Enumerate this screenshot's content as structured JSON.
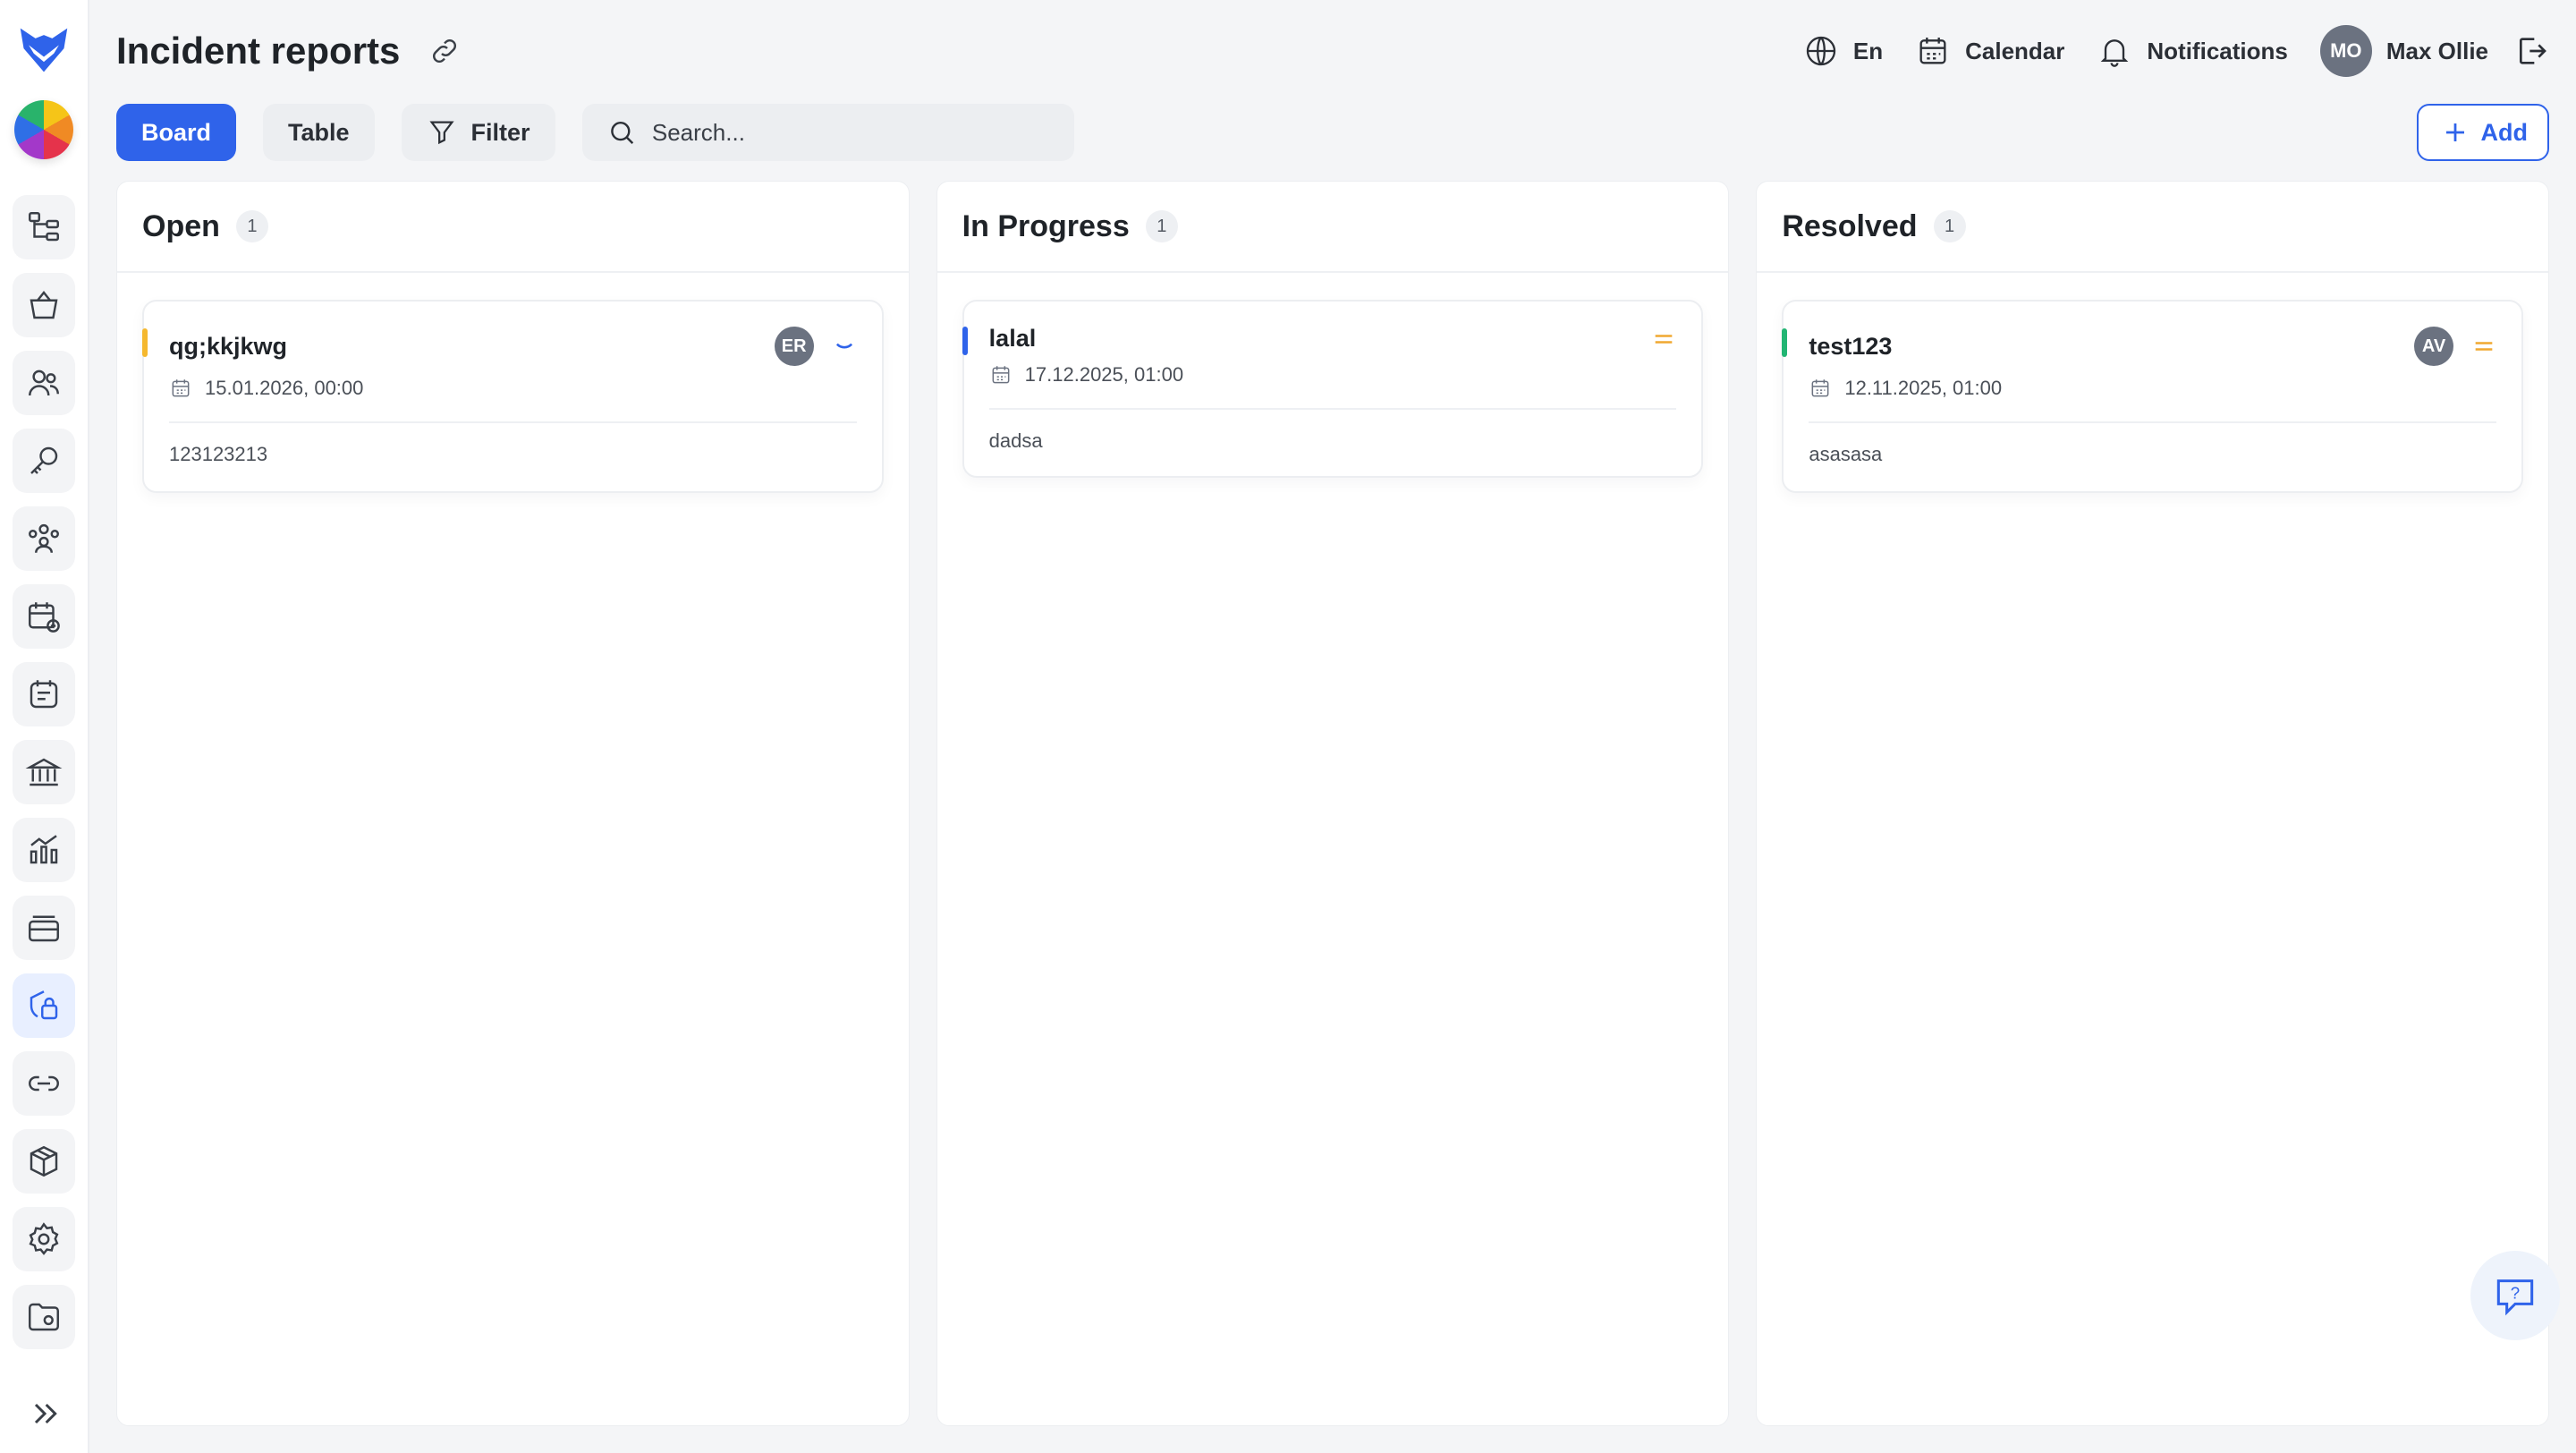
{
  "header": {
    "title": "Incident reports",
    "language": "En",
    "calendar": "Calendar",
    "notifications": "Notifications",
    "user_initials": "MO",
    "user_name": "Max Ollie"
  },
  "toolbar": {
    "board": "Board",
    "table": "Table",
    "filter": "Filter",
    "search_placeholder": "Search...",
    "add": "Add"
  },
  "columns": [
    {
      "title": "Open",
      "count": "1",
      "card": {
        "title": "qg;kkjkwg",
        "date": "15.01.2026, 00:00",
        "description": "123123213",
        "assignee": "ER",
        "priority": "low",
        "accent": "#f5b82e"
      }
    },
    {
      "title": "In Progress",
      "count": "1",
      "card": {
        "title": "lalal",
        "date": "17.12.2025, 01:00",
        "description": "dadsa",
        "assignee": "",
        "priority": "medium",
        "accent": "#2f63ea"
      }
    },
    {
      "title": "Resolved",
      "count": "1",
      "card": {
        "title": "test123",
        "date": "12.11.2025, 01:00",
        "description": "asasasa",
        "assignee": "AV",
        "priority": "medium",
        "accent": "#22b573"
      }
    }
  ],
  "colors": {
    "primary": "#2f63ea",
    "priority_medium": "#f0a830",
    "priority_low": "#2f63ea"
  },
  "sidebar": {
    "icons": [
      "hierarchy-icon",
      "basket-icon",
      "users-icon",
      "key-icon",
      "group-icon",
      "calendar-add-icon",
      "note-icon",
      "bank-icon",
      "chart-icon",
      "cards-icon",
      "security-icon",
      "link-icon",
      "box-icon",
      "gear-icon",
      "folder-icon"
    ]
  }
}
